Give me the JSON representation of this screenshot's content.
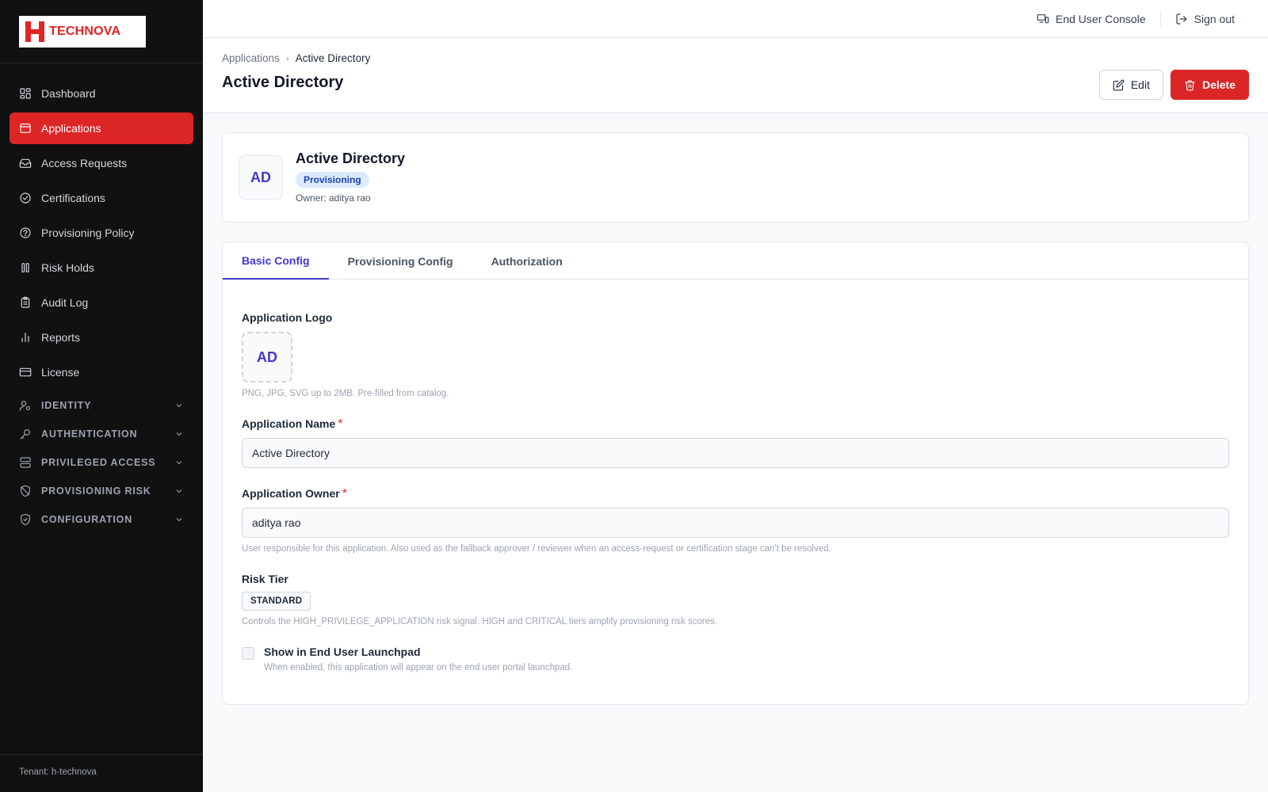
{
  "brand": {
    "name": "TECHNOVA",
    "logo_letter": "H",
    "accent": "#dc2626"
  },
  "sidebar": {
    "items": [
      {
        "label": "Dashboard",
        "icon": "dashboard-icon"
      },
      {
        "label": "Applications",
        "icon": "applications-icon",
        "active": true
      },
      {
        "label": "Access Requests",
        "icon": "inbox-icon"
      },
      {
        "label": "Certifications",
        "icon": "check-circle-icon"
      },
      {
        "label": "Provisioning Policy",
        "icon": "policy-icon"
      },
      {
        "label": "Risk Holds",
        "icon": "pause-icon"
      },
      {
        "label": "Audit Log",
        "icon": "clipboard-icon"
      },
      {
        "label": "Reports",
        "icon": "bar-chart-icon"
      },
      {
        "label": "License",
        "icon": "card-icon"
      }
    ],
    "groups": [
      {
        "label": "IDENTITY",
        "icon": "user-key-icon"
      },
      {
        "label": "AUTHENTICATION",
        "icon": "key-icon"
      },
      {
        "label": "PRIVILEGED ACCESS",
        "icon": "server-icon"
      },
      {
        "label": "PROVISIONING RISK",
        "icon": "shield-off-icon"
      },
      {
        "label": "CONFIGURATION",
        "icon": "shield-check-icon"
      }
    ],
    "tenant": "Tenant: h-technova"
  },
  "topbar": {
    "console_label": "End User Console",
    "signout_label": "Sign out"
  },
  "header": {
    "breadcrumb": [
      "Applications",
      "Active Directory"
    ],
    "title": "Active Directory",
    "edit_label": "Edit",
    "delete_label": "Delete"
  },
  "summary": {
    "initials": "AD",
    "name": "Active Directory",
    "badge": "Provisioning",
    "owner": "Owner: aditya rao"
  },
  "tabs": [
    {
      "label": "Basic Config",
      "active": true
    },
    {
      "label": "Provisioning Config"
    },
    {
      "label": "Authorization"
    }
  ],
  "form": {
    "logo_label": "Application Logo",
    "logo_initials": "AD",
    "logo_hint": "PNG, JPG, SVG up to 2MB. Pre-filled from catalog.",
    "name_label": "Application Name",
    "name_value": "Active Directory",
    "required_mark": "*",
    "owner_label": "Application Owner",
    "owner_value": "aditya rao",
    "owner_hint": "User responsible for this application. Also used as the fallback approver / reviewer when an access-request or certification stage can't be resolved.",
    "risk_label": "Risk Tier",
    "risk_value": "STANDARD",
    "risk_hint": "Controls the HIGH_PRIVILEGE_APPLICATION risk signal. HIGH and CRITICAL tiers amplify provisioning risk scores.",
    "launchpad_label": "Show in End User Launchpad",
    "launchpad_hint": "When enabled, this application will appear on the end user portal launchpad.",
    "launchpad_checked": false
  }
}
